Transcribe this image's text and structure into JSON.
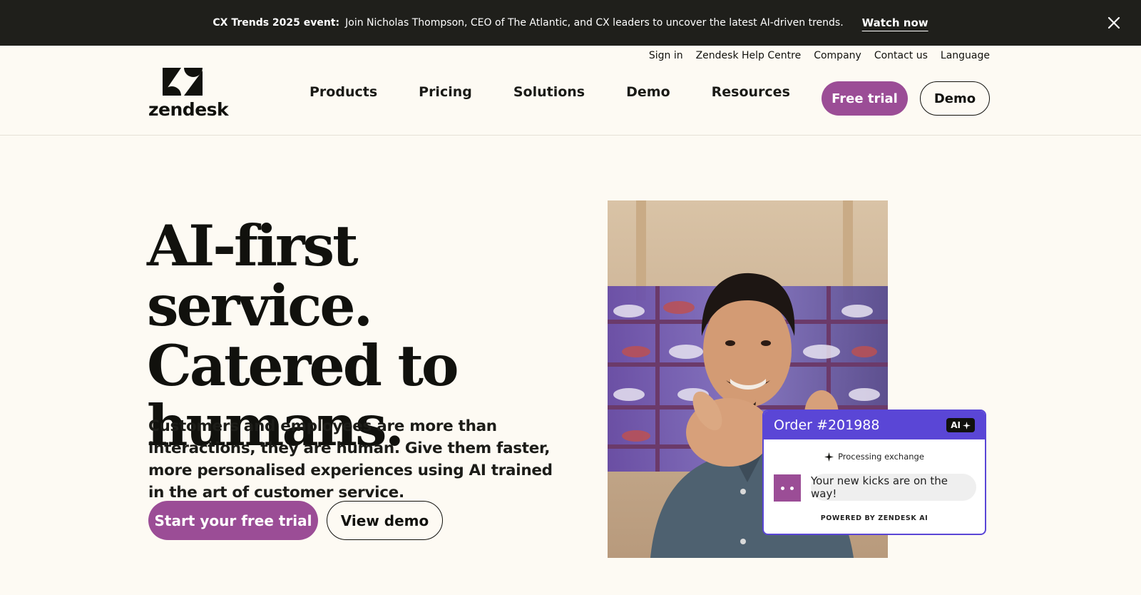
{
  "announcement": {
    "lead": "CX Trends 2025 event:",
    "message": "Join Nicholas Thompson, CEO of The Atlantic, and CX leaders to uncover the latest AI-driven trends.",
    "cta": "Watch now",
    "close_icon": "close-icon"
  },
  "utility_nav": [
    "Sign in",
    "Zendesk Help Centre",
    "Company",
    "Contact us",
    "Language"
  ],
  "logo": {
    "wordmark": "zendesk"
  },
  "main_nav": [
    "Products",
    "Pricing",
    "Solutions",
    "Demo",
    "Resources"
  ],
  "header_buttons": {
    "trial": "Free trial",
    "demo": "Demo"
  },
  "hero": {
    "headline_lines": [
      "AI-first service.",
      "Catered to",
      "humans."
    ],
    "subcopy": "Customers and employees are more than interactions, they are human. Give them faster, more personalised experiences using AI trained in the art of customer service.",
    "primary_cta": "Start your free trial",
    "secondary_cta": "View demo"
  },
  "ai_card": {
    "title": "Order #201988",
    "badge": "AI",
    "status": "Processing exchange",
    "message": "Your new kicks are on the way!",
    "footer": "POWERED BY ZENDESK AI"
  },
  "colors": {
    "brand_purple": "#9b4d96",
    "ai_blue": "#5a46d6",
    "announcement_bg": "#1f1f1b",
    "page_bg": "#fdfaf3"
  }
}
